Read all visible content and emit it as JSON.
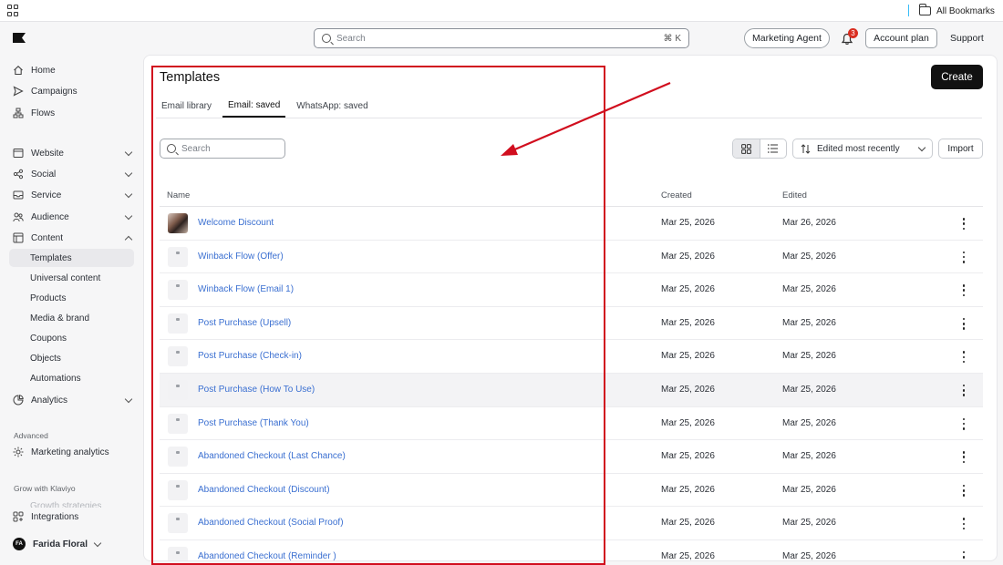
{
  "bookmarks_bar": {
    "all_bookmarks": "All Bookmarks"
  },
  "header": {
    "search_placeholder": "Search",
    "search_shortcut": "⌘ K",
    "marketing_agent": "Marketing Agent",
    "notifications_count": "3",
    "account_plan": "Account plan",
    "support": "Support"
  },
  "sidebar": {
    "items": [
      {
        "label": "Home",
        "icon": "home-icon"
      },
      {
        "label": "Campaigns",
        "icon": "send-icon"
      },
      {
        "label": "Flows",
        "icon": "flows-icon"
      },
      {
        "label": "Website",
        "icon": "website-icon"
      },
      {
        "label": "Social",
        "icon": "social-icon"
      },
      {
        "label": "Service",
        "icon": "inbox-icon"
      },
      {
        "label": "Audience",
        "icon": "people-icon"
      },
      {
        "label": "Content",
        "icon": "content-icon"
      }
    ],
    "content_subitems": [
      "Templates",
      "Universal content",
      "Products",
      "Media & brand",
      "Coupons",
      "Objects",
      "Automations"
    ],
    "analytics": "Analytics",
    "advanced_label": "Advanced",
    "marketing_analytics": "Marketing analytics",
    "grow_label": "Grow with Klaviyo",
    "growth_strategies": "Growth strategies",
    "integrations": "Integrations",
    "account": {
      "initials": "FA",
      "name": "Farida Floral"
    }
  },
  "main": {
    "title": "Templates",
    "create_button": "Create",
    "tabs": [
      "Email library",
      "Email: saved",
      "WhatsApp: saved"
    ],
    "active_tab": "Email: saved",
    "search_placeholder": "Search",
    "sort_label": "Edited most recently",
    "import_button": "Import",
    "columns": {
      "name": "Name",
      "created": "Created",
      "edited": "Edited"
    },
    "rows": [
      {
        "name": "Welcome Discount",
        "created": "Mar 25, 2026",
        "edited": "Mar 26, 2026"
      },
      {
        "name": "Winback Flow (Offer)",
        "created": "Mar 25, 2026",
        "edited": "Mar 25, 2026"
      },
      {
        "name": "Winback Flow (Email 1)",
        "created": "Mar 25, 2026",
        "edited": "Mar 25, 2026"
      },
      {
        "name": "Post Purchase (Upsell)",
        "created": "Mar 25, 2026",
        "edited": "Mar 25, 2026"
      },
      {
        "name": "Post Purchase (Check-in)",
        "created": "Mar 25, 2026",
        "edited": "Mar 25, 2026"
      },
      {
        "name": "Post Purchase (How To Use)",
        "created": "Mar 25, 2026",
        "edited": "Mar 25, 2026"
      },
      {
        "name": "Post Purchase (Thank You)",
        "created": "Mar 25, 2026",
        "edited": "Mar 25, 2026"
      },
      {
        "name": "Abandoned Checkout (Last Chance)",
        "created": "Mar 25, 2026",
        "edited": "Mar 25, 2026"
      },
      {
        "name": "Abandoned Checkout (Discount)",
        "created": "Mar 25, 2026",
        "edited": "Mar 25, 2026"
      },
      {
        "name": "Abandoned Checkout (Social Proof)",
        "created": "Mar 25, 2026",
        "edited": "Mar 25, 2026"
      },
      {
        "name": "Abandoned Checkout (Reminder )",
        "created": "Mar 25, 2026",
        "edited": "Mar 25, 2026"
      }
    ]
  },
  "colors": {
    "link": "#3a6fd1",
    "annotation": "#d10e1e",
    "badge": "#d92d20"
  }
}
